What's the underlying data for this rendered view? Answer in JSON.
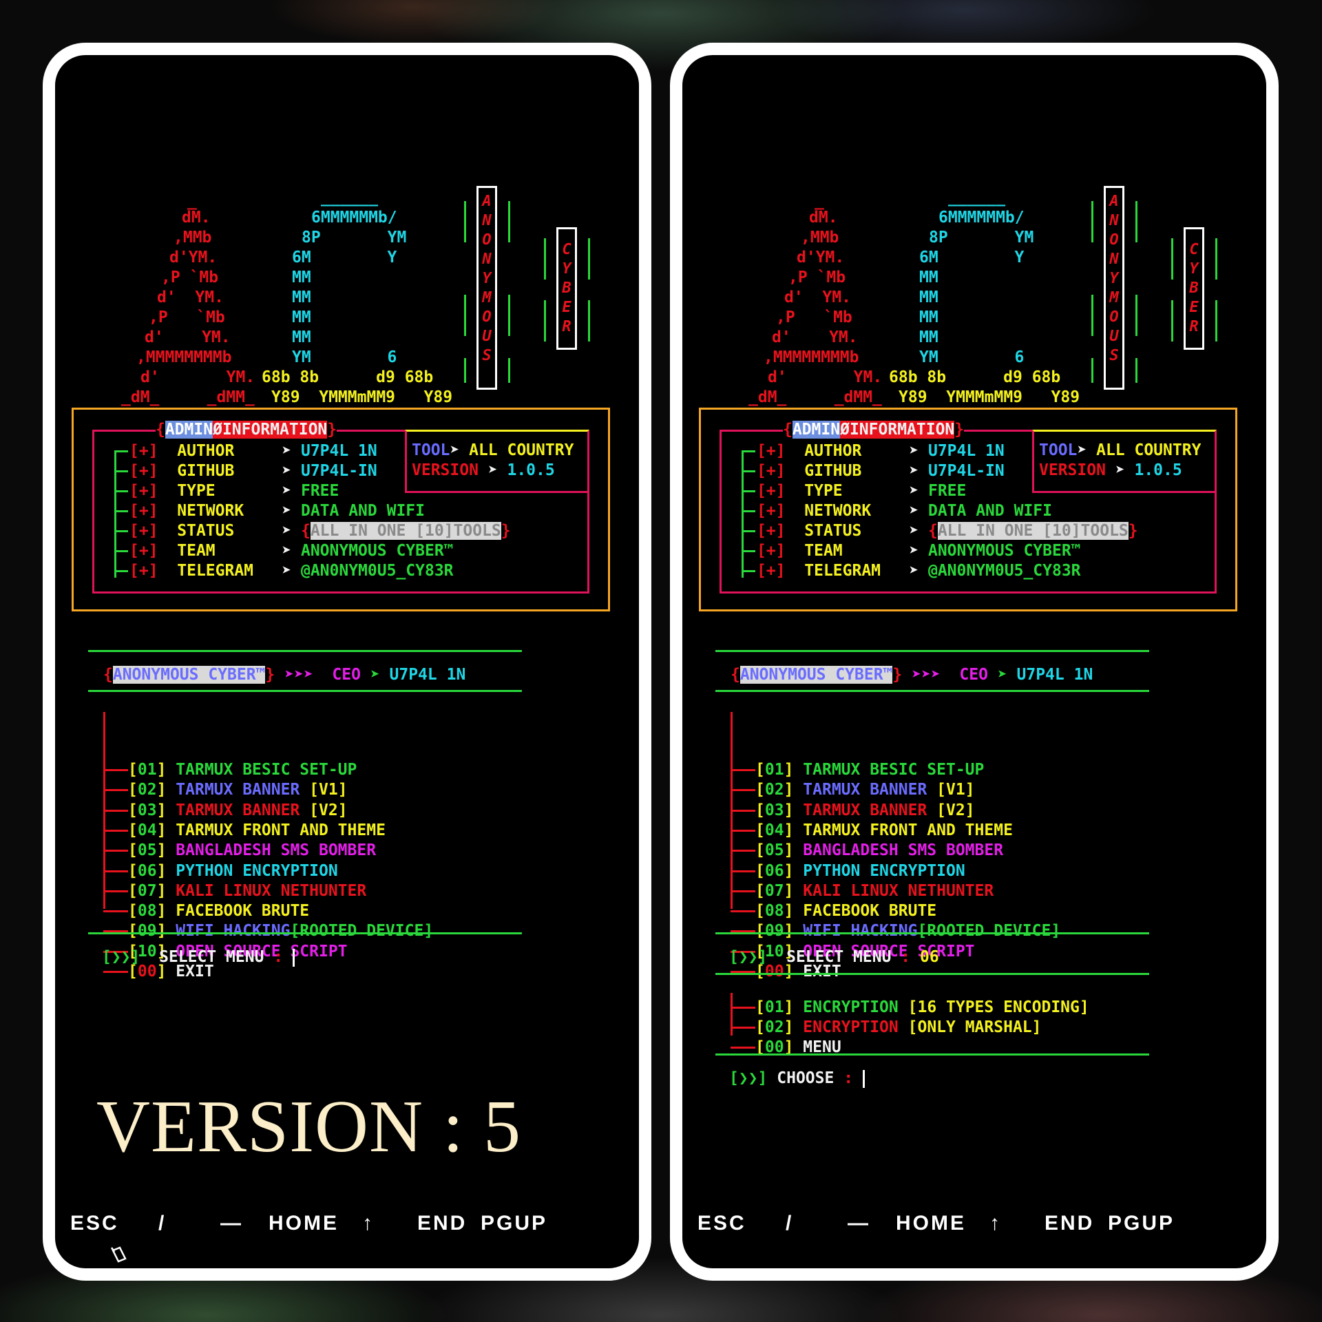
{
  "banner": {
    "art_a": [
      "_",
      "dM.",
      ",MMb",
      "d'YM.",
      ",P `Mb",
      "d'  YM.",
      ",P   `Mb",
      "d'    YM.",
      ",MMMMMMMMb",
      "d'       YM.",
      "_dM_     _dMM_"
    ],
    "art_c": [
      "______",
      "6MMMMMMb/",
      "8P       YM",
      "6M        Y",
      "MM",
      "MM",
      "MM",
      "MM",
      "YM        6",
      "68b 8b      d9 68b",
      "Y89  YMMMmMM9   Y89"
    ],
    "vertical_1": [
      "A",
      "N",
      "O",
      "N",
      "Y",
      "M",
      "O",
      "U",
      "S"
    ],
    "vertical_2": [
      "C",
      "Y",
      "B",
      "E",
      "R"
    ]
  },
  "admin": {
    "title_hl": "ADMIN",
    "title_rest": "ØINFORMATION",
    "marker": "[+]",
    "arrow": "➤",
    "rows": [
      {
        "key": "AUTHOR",
        "value": "U7P4L 1N"
      },
      {
        "key": "GITHUB",
        "value": "U7P4L-IN"
      },
      {
        "key": "TYPE",
        "value": "FREE"
      },
      {
        "key": "NETWORK",
        "value": "DATA AND WIFI"
      },
      {
        "key": "STATUS",
        "value": "ALL IN ONE [10]TOOLS"
      },
      {
        "key": "TEAM",
        "value": "ANONYMOUS CYBER™"
      },
      {
        "key": "TELEGRAM",
        "value": "@AN0NYM0U5_CY83R"
      }
    ],
    "tool_label": "TOOL",
    "tool_value": "ALL COUNTRY",
    "version_label": "VERSION",
    "version_value": "1.0.5"
  },
  "header": {
    "team": "ANONYMOUS CYBER™",
    "arrows": "➤➤➤",
    "ceo_label": "CEO",
    "ceo_arrow": "➤",
    "ceo_name": "U7P4L 1N"
  },
  "menu": [
    {
      "num": "01",
      "label": "TARMUX BESIC SET-UP",
      "extra": ""
    },
    {
      "num": "02",
      "label": "TARMUX BANNER",
      "extra": "[V1]"
    },
    {
      "num": "03",
      "label": "TARMUX BANNER",
      "extra": "[V2]"
    },
    {
      "num": "04",
      "label": "TARMUX FRONT AND THEME",
      "extra": ""
    },
    {
      "num": "05",
      "label": "BANGLADESH SMS BOMBER",
      "extra": ""
    },
    {
      "num": "06",
      "label": "PYTHON ENCRYPTION",
      "extra": ""
    },
    {
      "num": "07",
      "label": "KALI LINUX NETHUNTER",
      "extra": ""
    },
    {
      "num": "08",
      "label": "FACEBOOK BRUTE",
      "extra": ""
    },
    {
      "num": "09",
      "label": "WIFI HACKING",
      "extra": "[ROOTED DEVICE]"
    },
    {
      "num": "10",
      "label": "OPEN SOURCE SCRIPT",
      "extra": ""
    },
    {
      "num": "00",
      "label": "EXIT",
      "extra": ""
    }
  ],
  "prompt": {
    "symbol": "[❯❯]",
    "select_label": "SELECT MENU",
    "colon": ":",
    "left_value": "",
    "right_value": "06"
  },
  "submenu": [
    {
      "num": "01",
      "label": "ENCRYPTION",
      "extra": "[16 TYPES ENCODING]"
    },
    {
      "num": "02",
      "label": "ENCRYPTION",
      "extra": "[ONLY MARSHAL]"
    },
    {
      "num": "00",
      "label": "MENU",
      "extra": ""
    }
  ],
  "choose": {
    "label": "CHOOSE",
    "colon": ":"
  },
  "caption": "VERSION : 5",
  "keys": [
    "ESC",
    "/",
    "—",
    "HOME",
    "↑",
    "END",
    "PGUP"
  ],
  "colors": {
    "red": "#e8121d",
    "cyan": "#1fd6e6",
    "yellow": "#f4f11f",
    "green": "#2ad83b",
    "blue": "#6a6cff",
    "magenta": "#e31fe8",
    "orange": "#f5a623",
    "pink": "#e0125a"
  }
}
